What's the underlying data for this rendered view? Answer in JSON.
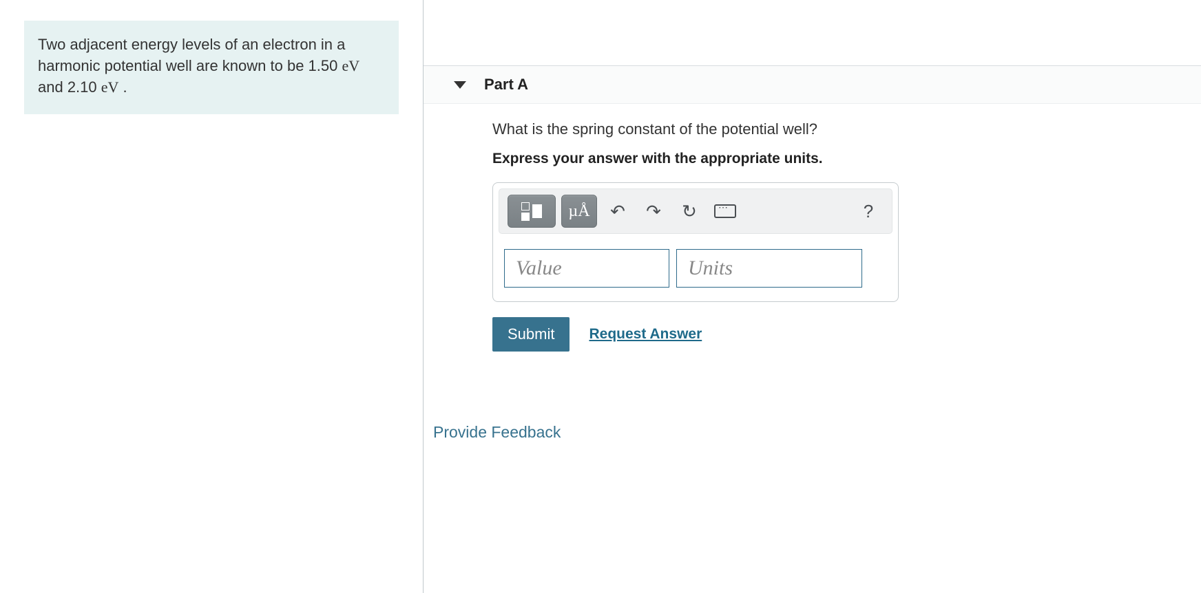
{
  "problem": {
    "text_prefix": "Two adjacent energy levels of an electron in a harmonic potential well are known to be 1.50 ",
    "unit1": "eV",
    "text_mid": " and 2.10 ",
    "unit2": "eV",
    "text_suffix": " ."
  },
  "part": {
    "title": "Part A",
    "question": "What is the spring constant of the potential well?",
    "instruction": "Express your answer with the appropriate units."
  },
  "toolbar": {
    "special_chars": "µÅ",
    "undo": "↶",
    "redo": "↷",
    "reset": "↻",
    "help": "?"
  },
  "inputs": {
    "value_placeholder": "Value",
    "units_placeholder": "Units"
  },
  "actions": {
    "submit": "Submit",
    "request_answer": "Request Answer"
  },
  "feedback": "Provide Feedback"
}
